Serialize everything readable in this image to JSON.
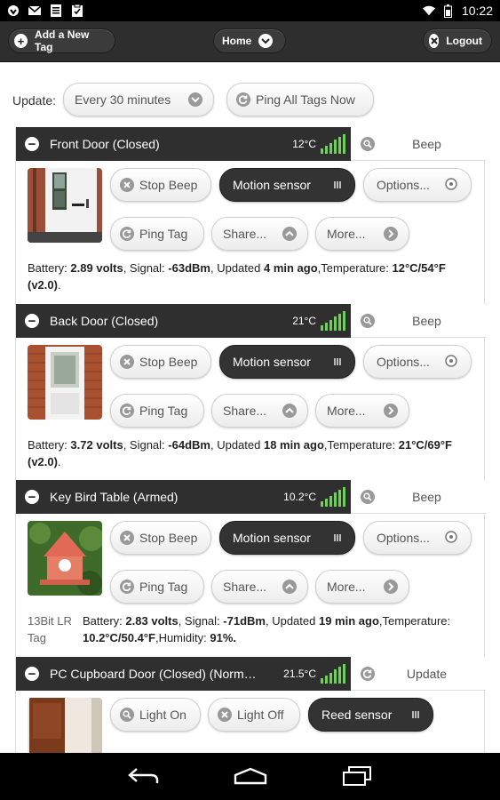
{
  "statusbar": {
    "time": "10:22"
  },
  "header": {
    "add_tag": "Add a New Tag",
    "home": "Home",
    "logout": "Logout"
  },
  "update": {
    "label": "Update:",
    "interval": "Every 30 minutes",
    "ping_all": "Ping All Tags Now"
  },
  "tags": [
    {
      "name": "Front Door (Closed)",
      "temp": "12°C",
      "side_action": "Beep",
      "buttons": [
        "Stop Beep",
        "Motion sensor",
        "Options...",
        "Ping Tag",
        "Share...",
        "More..."
      ],
      "info": {
        "battery_label": "Battery:",
        "battery": "2.89 volts",
        "signal_label": ", Signal:",
        "signal": "-63dBm",
        "updated_label": ", Updated",
        "updated": "4 min ago",
        "temp_label": ",Temperature:",
        "temp": "12°C/54°F (v2.0)",
        "extra_label": ".",
        "extra": ""
      }
    },
    {
      "name": "Back Door (Closed)",
      "temp": "21°C",
      "side_action": "Beep",
      "buttons": [
        "Stop Beep",
        "Motion sensor",
        "Options...",
        "Ping Tag",
        "Share...",
        "More..."
      ],
      "info": {
        "battery_label": "Battery:",
        "battery": "3.72 volts",
        "signal_label": ", Signal:",
        "signal": "-64dBm",
        "updated_label": ", Updated",
        "updated": "18 min ago",
        "temp_label": ",Temperature:",
        "temp": "21°C/69°F (v2.0)",
        "extra_label": ".",
        "extra": ""
      }
    },
    {
      "name": "Key Bird Table (Armed)",
      "temp": "10.2°C",
      "side_action": "Beep",
      "tag_type": "13Bit LR Tag",
      "buttons": [
        "Stop Beep",
        "Motion sensor",
        "Options...",
        "Ping Tag",
        "Share...",
        "More..."
      ],
      "info": {
        "battery_label": "Battery:",
        "battery": "2.83 volts",
        "signal_label": ", Signal:",
        "signal": "-71dBm",
        "updated_label": ", Updated",
        "updated": "19 min ago",
        "temp_label": ",Temperature:",
        "temp": "10.2°C/50.4°F",
        "extra_label": ",Humidity:",
        "extra": "91%."
      }
    },
    {
      "name": "PC Cupboard Door (Closed) (Normal ...",
      "temp": "21.5°C",
      "side_action": "Update",
      "buttons": [
        "Light On",
        "Light Off",
        "Reed sensor"
      ]
    }
  ]
}
